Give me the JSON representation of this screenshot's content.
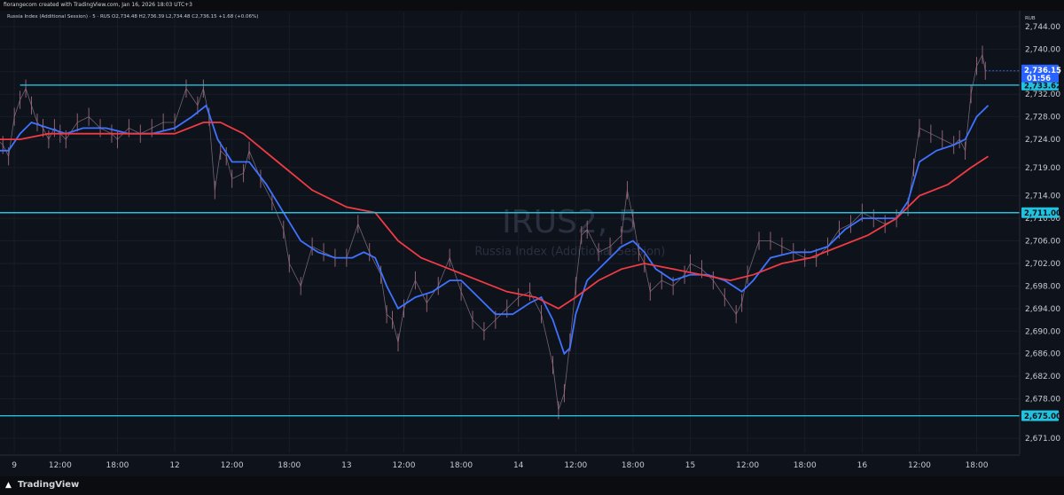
{
  "header": {
    "created": "fiorangecom created with TradingView.com, Jan 16, 2026 18:03 UTC+3"
  },
  "footer": {
    "brand": "TradingView"
  },
  "chart_data": {
    "type": "line",
    "symbol_watermark": "IRUS2, 5",
    "description_watermark": "Russia Index (Additional Session)",
    "legend": {
      "name": "Russia Index (Additional Session) · 5 · RUS",
      "open": "O2,734.48",
      "high": "H2,736.39",
      "low": "L2,734.48",
      "close": "C2,736.15",
      "change": "+1.68 (+0.06%)"
    },
    "currency": "RUB",
    "y_ticks": [
      2671,
      2675,
      2678,
      2682,
      2686,
      2690,
      2694,
      2698,
      2702,
      2706,
      2710,
      2714,
      2719,
      2724,
      2728,
      2732,
      2736,
      2740,
      2744
    ],
    "y_tick_labels": [
      "2,671.00",
      "2,675.00",
      "2,678.00",
      "2,682.00",
      "2,686.00",
      "2,690.00",
      "2,694.00",
      "2,698.00",
      "2,702.00",
      "2,706.00",
      "2,710.00",
      "2,714.00",
      "2,719.00",
      "2,724.00",
      "2,728.00",
      "2,732.00",
      "2,736.00",
      "2,740.00",
      "2,744.00"
    ],
    "x_ticks": [
      {
        "label": "9",
        "t": 0.2
      },
      {
        "label": "12:00",
        "t": 1.0
      },
      {
        "label": "18:00",
        "t": 2.0
      },
      {
        "label": "12",
        "t": 3.0
      },
      {
        "label": "12:00",
        "t": 4.0
      },
      {
        "label": "18:00",
        "t": 5.0
      },
      {
        "label": "13",
        "t": 6.0
      },
      {
        "label": "12:00",
        "t": 7.0
      },
      {
        "label": "18:00",
        "t": 8.0
      },
      {
        "label": "14",
        "t": 9.0
      },
      {
        "label": "12:00",
        "t": 10.0
      },
      {
        "label": "18:00",
        "t": 11.0
      },
      {
        "label": "15",
        "t": 12.0
      },
      {
        "label": "12:00",
        "t": 13.0
      },
      {
        "label": "18:00",
        "t": 14.0
      },
      {
        "label": "16",
        "t": 15.0
      },
      {
        "label": "12:00",
        "t": 16.0
      },
      {
        "label": "18:00",
        "t": 17.0
      }
    ],
    "horizontal_levels": [
      {
        "value": 2733.62,
        "label": "2,733.62",
        "from_t": 0.3
      },
      {
        "value": 2711.0,
        "label": "2,711.00",
        "from_t": -0.1
      },
      {
        "value": 2675.0,
        "label": "2,675.00",
        "from_t": -0.1
      }
    ],
    "last_price": {
      "value": 2736.15,
      "label": "2,736.15",
      "countdown": "01:56"
    },
    "price_points": [
      [
        -0.1,
        2724
      ],
      [
        0.0,
        2723
      ],
      [
        0.1,
        2721
      ],
      [
        0.2,
        2728
      ],
      [
        0.3,
        2731
      ],
      [
        0.4,
        2733
      ],
      [
        0.5,
        2730
      ],
      [
        0.6,
        2727
      ],
      [
        0.7,
        2726
      ],
      [
        0.8,
        2724
      ],
      [
        0.9,
        2726
      ],
      [
        1.0,
        2725
      ],
      [
        1.1,
        2724
      ],
      [
        1.3,
        2727
      ],
      [
        1.5,
        2728
      ],
      [
        1.7,
        2726
      ],
      [
        1.9,
        2725
      ],
      [
        2.0,
        2724
      ],
      [
        2.2,
        2726
      ],
      [
        2.4,
        2725
      ],
      [
        2.6,
        2726
      ],
      [
        2.8,
        2727
      ],
      [
        3.0,
        2727
      ],
      [
        3.2,
        2733
      ],
      [
        3.4,
        2730
      ],
      [
        3.5,
        2733
      ],
      [
        3.6,
        2728
      ],
      [
        3.7,
        2715
      ],
      [
        3.8,
        2722
      ],
      [
        3.9,
        2721
      ],
      [
        4.0,
        2717
      ],
      [
        4.2,
        2718
      ],
      [
        4.3,
        2722
      ],
      [
        4.5,
        2717
      ],
      [
        4.7,
        2713
      ],
      [
        4.9,
        2708
      ],
      [
        5.0,
        2702
      ],
      [
        5.2,
        2698
      ],
      [
        5.4,
        2705
      ],
      [
        5.6,
        2704
      ],
      [
        5.8,
        2703
      ],
      [
        6.0,
        2703
      ],
      [
        6.2,
        2709
      ],
      [
        6.4,
        2704
      ],
      [
        6.6,
        2700
      ],
      [
        6.7,
        2693
      ],
      [
        6.8,
        2692
      ],
      [
        6.9,
        2688
      ],
      [
        7.0,
        2694
      ],
      [
        7.2,
        2699
      ],
      [
        7.4,
        2695
      ],
      [
        7.6,
        2698
      ],
      [
        7.8,
        2703
      ],
      [
        8.0,
        2697
      ],
      [
        8.2,
        2692
      ],
      [
        8.4,
        2690
      ],
      [
        8.6,
        2692
      ],
      [
        8.8,
        2694
      ],
      [
        9.0,
        2696
      ],
      [
        9.2,
        2697
      ],
      [
        9.4,
        2693
      ],
      [
        9.6,
        2684
      ],
      [
        9.7,
        2676
      ],
      [
        9.8,
        2679
      ],
      [
        9.9,
        2688
      ],
      [
        10.0,
        2698
      ],
      [
        10.1,
        2707
      ],
      [
        10.2,
        2708
      ],
      [
        10.4,
        2704
      ],
      [
        10.6,
        2705
      ],
      [
        10.8,
        2707
      ],
      [
        10.9,
        2715
      ],
      [
        11.0,
        2710
      ],
      [
        11.1,
        2704
      ],
      [
        11.2,
        2702
      ],
      [
        11.3,
        2697
      ],
      [
        11.5,
        2699
      ],
      [
        11.7,
        2698
      ],
      [
        11.9,
        2700
      ],
      [
        12.0,
        2702
      ],
      [
        12.2,
        2701
      ],
      [
        12.4,
        2699
      ],
      [
        12.6,
        2696
      ],
      [
        12.8,
        2693
      ],
      [
        12.9,
        2695
      ],
      [
        13.0,
        2700
      ],
      [
        13.2,
        2706
      ],
      [
        13.4,
        2706
      ],
      [
        13.6,
        2705
      ],
      [
        13.8,
        2704
      ],
      [
        14.0,
        2703
      ],
      [
        14.2,
        2703
      ],
      [
        14.4,
        2705
      ],
      [
        14.6,
        2708
      ],
      [
        14.8,
        2709
      ],
      [
        15.0,
        2711
      ],
      [
        15.2,
        2710
      ],
      [
        15.4,
        2709
      ],
      [
        15.6,
        2710
      ],
      [
        15.8,
        2712
      ],
      [
        15.9,
        2719
      ],
      [
        16.0,
        2726
      ],
      [
        16.2,
        2725
      ],
      [
        16.4,
        2724
      ],
      [
        16.6,
        2723
      ],
      [
        16.7,
        2724
      ],
      [
        16.8,
        2722
      ],
      [
        16.9,
        2732
      ],
      [
        17.0,
        2737
      ],
      [
        17.1,
        2739
      ],
      [
        17.15,
        2736.15
      ]
    ],
    "series": [
      {
        "color": "#3f72ff",
        "points": [
          [
            -0.1,
            2722
          ],
          [
            0.1,
            2722
          ],
          [
            0.3,
            2725
          ],
          [
            0.5,
            2727
          ],
          [
            0.8,
            2726
          ],
          [
            1.1,
            2725
          ],
          [
            1.4,
            2726
          ],
          [
            1.8,
            2726
          ],
          [
            2.2,
            2725
          ],
          [
            2.6,
            2725
          ],
          [
            3.0,
            2726
          ],
          [
            3.3,
            2728
          ],
          [
            3.55,
            2730
          ],
          [
            3.75,
            2724
          ],
          [
            4.0,
            2720
          ],
          [
            4.3,
            2720
          ],
          [
            4.6,
            2716
          ],
          [
            4.9,
            2711
          ],
          [
            5.2,
            2706
          ],
          [
            5.5,
            2704
          ],
          [
            5.8,
            2703
          ],
          [
            6.1,
            2703
          ],
          [
            6.3,
            2704
          ],
          [
            6.5,
            2703
          ],
          [
            6.7,
            2698
          ],
          [
            6.9,
            2694
          ],
          [
            7.2,
            2696
          ],
          [
            7.5,
            2697
          ],
          [
            7.8,
            2699
          ],
          [
            8.0,
            2699
          ],
          [
            8.3,
            2696
          ],
          [
            8.6,
            2693
          ],
          [
            8.9,
            2693
          ],
          [
            9.2,
            2695
          ],
          [
            9.4,
            2696
          ],
          [
            9.6,
            2692
          ],
          [
            9.8,
            2686
          ],
          [
            9.9,
            2687
          ],
          [
            10.0,
            2693
          ],
          [
            10.2,
            2699
          ],
          [
            10.5,
            2702
          ],
          [
            10.8,
            2705
          ],
          [
            11.0,
            2706
          ],
          [
            11.2,
            2704
          ],
          [
            11.4,
            2701
          ],
          [
            11.7,
            2699
          ],
          [
            12.0,
            2700
          ],
          [
            12.3,
            2700
          ],
          [
            12.6,
            2699
          ],
          [
            12.9,
            2697
          ],
          [
            13.1,
            2699
          ],
          [
            13.4,
            2703
          ],
          [
            13.8,
            2704
          ],
          [
            14.1,
            2704
          ],
          [
            14.4,
            2705
          ],
          [
            14.7,
            2708
          ],
          [
            15.0,
            2710
          ],
          [
            15.3,
            2710
          ],
          [
            15.6,
            2710
          ],
          [
            15.8,
            2713
          ],
          [
            16.0,
            2720
          ],
          [
            16.3,
            2722
          ],
          [
            16.6,
            2723
          ],
          [
            16.8,
            2724
          ],
          [
            17.0,
            2728
          ],
          [
            17.2,
            2730
          ]
        ]
      },
      {
        "color": "#ef3b43",
        "points": [
          [
            -0.1,
            2724
          ],
          [
            0.3,
            2724
          ],
          [
            0.8,
            2725
          ],
          [
            1.5,
            2725
          ],
          [
            2.2,
            2725
          ],
          [
            3.0,
            2725
          ],
          [
            3.5,
            2727
          ],
          [
            3.8,
            2727
          ],
          [
            4.2,
            2725
          ],
          [
            4.8,
            2720
          ],
          [
            5.4,
            2715
          ],
          [
            6.0,
            2712
          ],
          [
            6.5,
            2711
          ],
          [
            6.9,
            2706
          ],
          [
            7.3,
            2703
          ],
          [
            7.8,
            2701
          ],
          [
            8.3,
            2699
          ],
          [
            8.8,
            2697
          ],
          [
            9.3,
            2696
          ],
          [
            9.7,
            2694
          ],
          [
            10.0,
            2696
          ],
          [
            10.4,
            2699
          ],
          [
            10.8,
            2701
          ],
          [
            11.2,
            2702
          ],
          [
            11.7,
            2701
          ],
          [
            12.2,
            2700
          ],
          [
            12.7,
            2699
          ],
          [
            13.1,
            2700
          ],
          [
            13.6,
            2702
          ],
          [
            14.1,
            2703
          ],
          [
            14.6,
            2705
          ],
          [
            15.1,
            2707
          ],
          [
            15.6,
            2710
          ],
          [
            16.0,
            2714
          ],
          [
            16.5,
            2716
          ],
          [
            16.9,
            2719
          ],
          [
            17.2,
            2721
          ]
        ]
      }
    ]
  }
}
